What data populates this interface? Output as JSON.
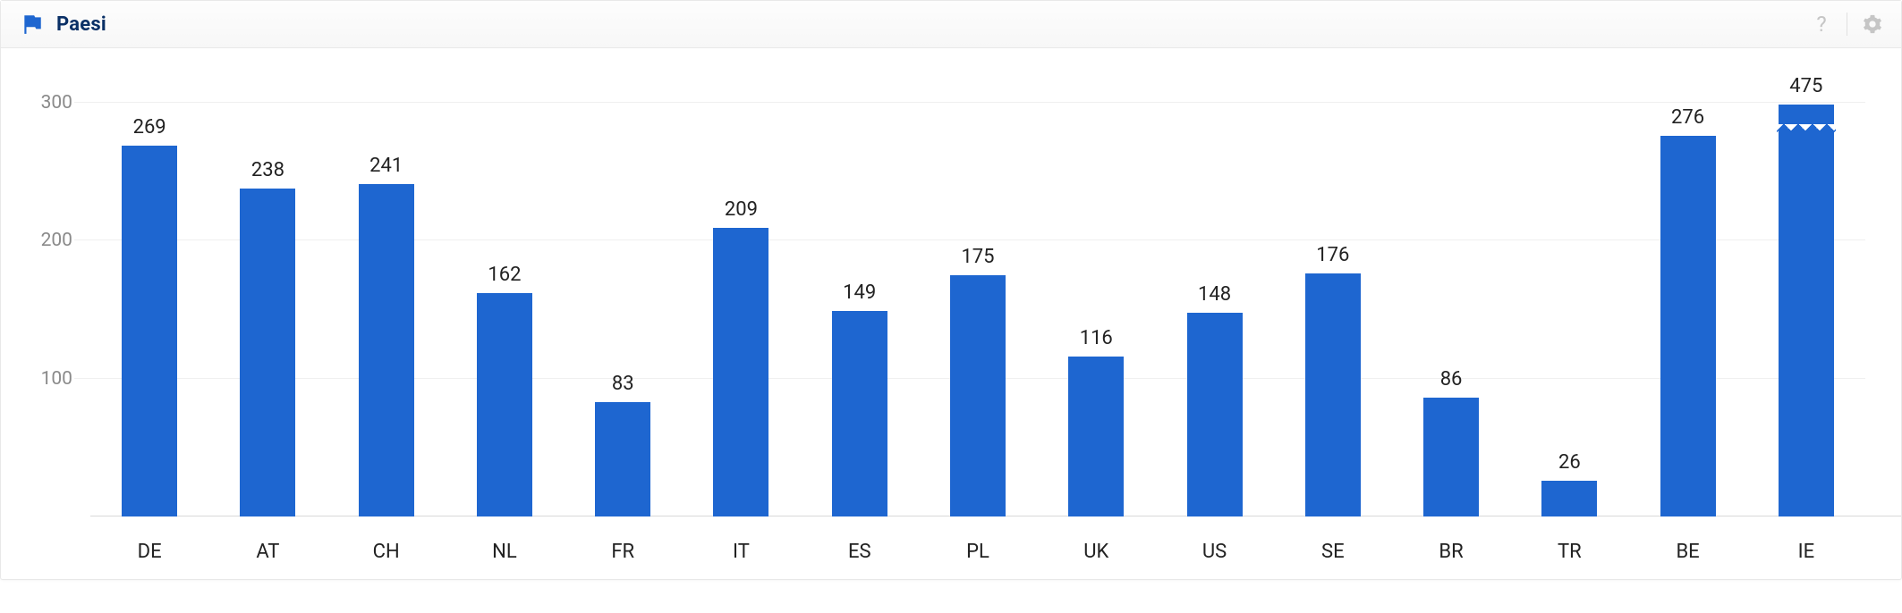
{
  "header": {
    "title": "Paesi",
    "help_icon": "?",
    "settings_icon": "gear"
  },
  "chart_data": {
    "type": "bar",
    "categories": [
      "DE",
      "AT",
      "CH",
      "NL",
      "FR",
      "IT",
      "ES",
      "PL",
      "UK",
      "US",
      "SE",
      "BR",
      "TR",
      "BE",
      "IE"
    ],
    "values": [
      269,
      238,
      241,
      162,
      83,
      209,
      149,
      175,
      116,
      148,
      176,
      86,
      26,
      276,
      475
    ],
    "title": "Paesi",
    "xlabel": "",
    "ylabel": "",
    "y_ticks": [
      100,
      200,
      300
    ],
    "ylim": [
      0,
      320
    ],
    "display_max": 320,
    "bar_color": "#1e66d0"
  }
}
